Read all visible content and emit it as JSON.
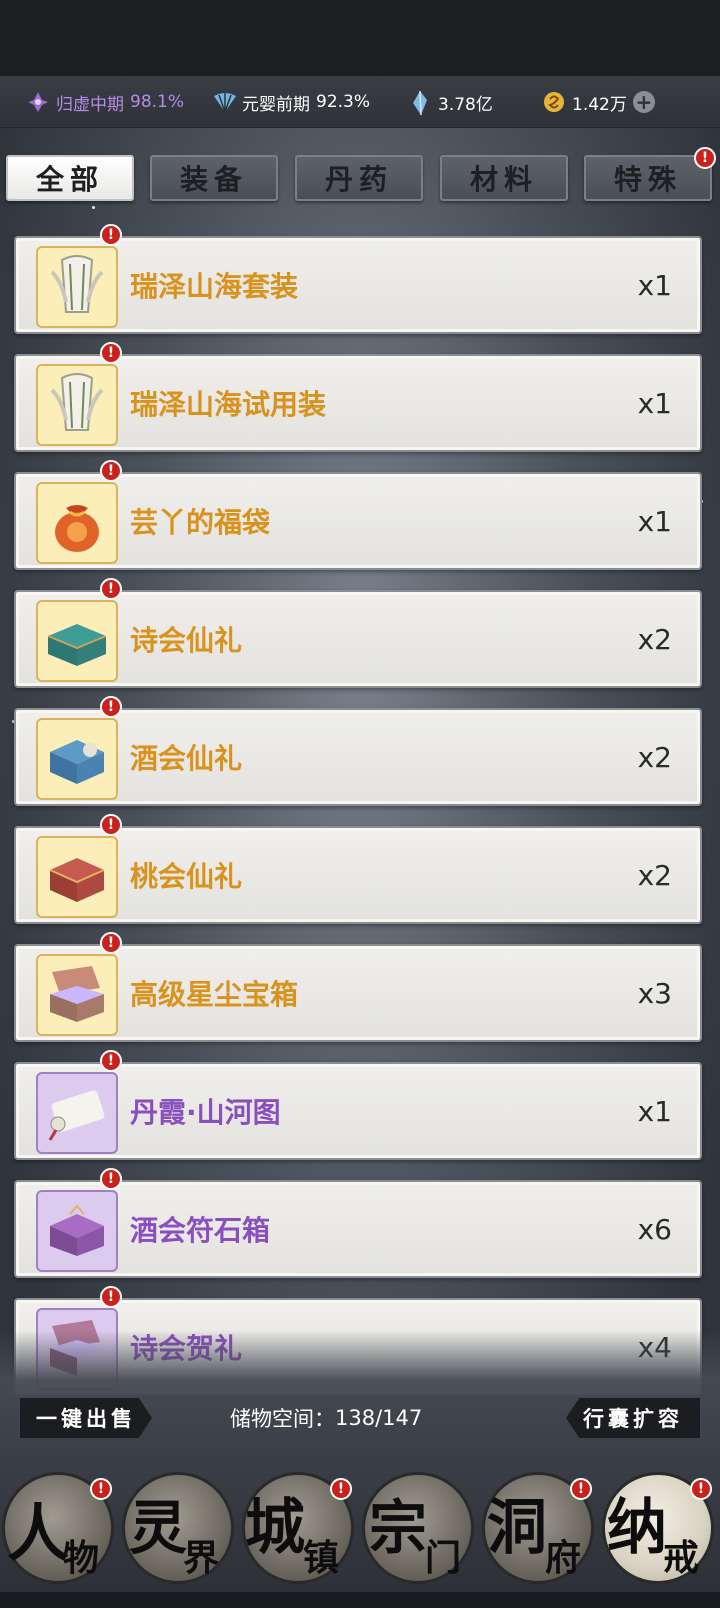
{
  "stats": [
    {
      "icon": "cultivation-realm-icon",
      "label": "归虚中期",
      "value": "98.1%",
      "color": "#b58ce6"
    },
    {
      "icon": "secondary-realm-icon",
      "label": "元婴前期",
      "value": "92.3%",
      "color": "#ffffff"
    },
    {
      "icon": "spirit-crystal-icon",
      "value": "3.78亿",
      "color": "#ffffff"
    },
    {
      "icon": "coin-icon",
      "value": "1.42万",
      "color": "#ffffff"
    }
  ],
  "tabs": [
    {
      "label": "全部",
      "active": true
    },
    {
      "label": "装备"
    },
    {
      "label": "丹药"
    },
    {
      "label": "材料"
    },
    {
      "label": "特殊"
    }
  ],
  "alert_mark": "!",
  "items": [
    {
      "name": "瑞泽山海套装",
      "count": "x1",
      "rarity": "gold",
      "icon": "outfit-icon"
    },
    {
      "name": "瑞泽山海试用装",
      "count": "x1",
      "rarity": "gold",
      "icon": "outfit-icon"
    },
    {
      "name": "芸丫的福袋",
      "count": "x1",
      "rarity": "gold",
      "icon": "lucky-bag-icon"
    },
    {
      "name": "诗会仙礼",
      "count": "x2",
      "rarity": "gold",
      "icon": "jade-chest-icon"
    },
    {
      "name": "酒会仙礼",
      "count": "x2",
      "rarity": "gold",
      "icon": "blue-chest-icon"
    },
    {
      "name": "桃会仙礼",
      "count": "x2",
      "rarity": "gold",
      "icon": "red-chest-icon"
    },
    {
      "name": "高级星尘宝箱",
      "count": "x3",
      "rarity": "gold",
      "icon": "stardust-chest-icon"
    },
    {
      "name": "丹霞·山河图",
      "count": "x1",
      "rarity": "purple",
      "icon": "scroll-icon"
    },
    {
      "name": "酒会符石箱",
      "count": "x6",
      "rarity": "purple",
      "icon": "purple-chest-icon"
    },
    {
      "name": "诗会贺礼",
      "count": "x4",
      "rarity": "purple",
      "icon": "purple-open-chest-icon"
    }
  ],
  "bottom": {
    "sell_all": "一键出售",
    "storage_label": "储物空间：",
    "storage_value": "138/147",
    "expand": "行囊扩容"
  },
  "nav": [
    {
      "big": "人",
      "small": "物",
      "alert": true
    },
    {
      "big": "灵",
      "small": "界",
      "alert": false
    },
    {
      "big": "城",
      "small": "镇",
      "alert": true
    },
    {
      "big": "宗",
      "small": "门",
      "alert": false
    },
    {
      "big": "洞",
      "small": "府",
      "alert": true
    },
    {
      "big": "纳",
      "small": "戒",
      "alert": true,
      "active": true
    }
  ]
}
